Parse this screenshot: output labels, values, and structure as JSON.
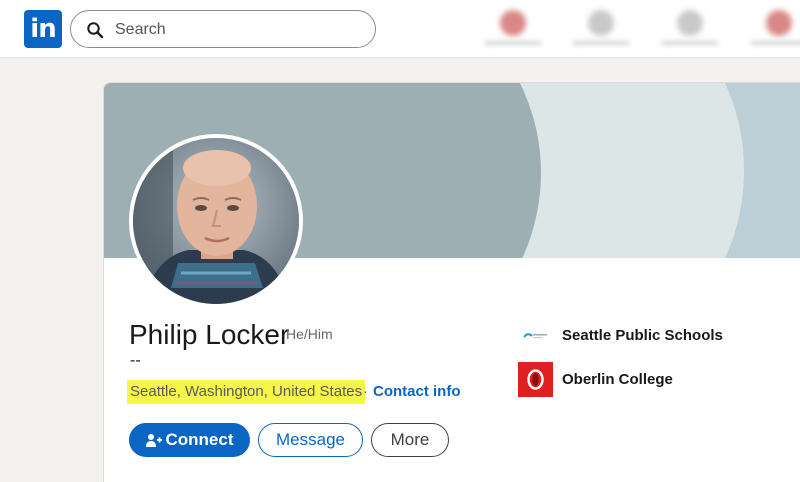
{
  "topbar": {
    "search_placeholder": "Search"
  },
  "profile": {
    "name": "Philip Locker",
    "pronouns": "He/Him",
    "headline": "--",
    "location": "Seattle, Washington, United States",
    "separator": "·",
    "contact_label": "Contact info"
  },
  "actions": {
    "connect": "Connect",
    "message": "Message",
    "more": "More"
  },
  "education": [
    {
      "name": "Seattle Public Schools",
      "icon": "seattle-public-schools-logo"
    },
    {
      "name": "Oberlin College",
      "icon": "oberlin-college-logo"
    }
  ],
  "colors": {
    "brand": "#0a66c2",
    "highlight": "#f6f54a",
    "oberlin_red": "#e0201f"
  }
}
